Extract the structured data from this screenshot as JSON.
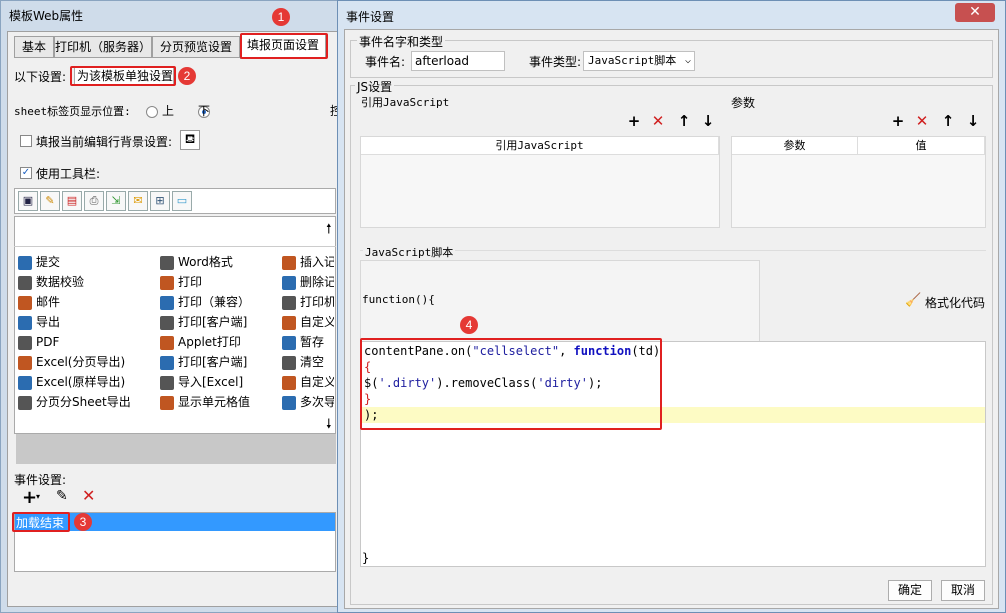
{
  "bg_window": {
    "title": "模板Web属性",
    "tabs": [
      "基本",
      "打印机（服务器）",
      "分页预览设置",
      "填报页面设置"
    ],
    "setting_label": "以下设置:",
    "setting_value": "为该模板单独设置",
    "sheet_pos_label": "sheet标签页显示位置:",
    "sheet_pos_top": "上",
    "sheet_pos_bottom": "下",
    "right_cut": "控",
    "fill_bg_label": "填报当前编辑行背景设置:",
    "use_toolbar_label": "使用工具栏:",
    "toolbar_icons": [
      "save-icon",
      "edit-icon",
      "pdf-icon",
      "print-icon",
      "export-icon",
      "mail-icon",
      "layout-icon",
      "sheet-icon"
    ],
    "grid_items": [
      [
        "提交",
        "Word格式",
        "插入记"
      ],
      [
        "数据校验",
        "打印",
        "删除记"
      ],
      [
        "邮件",
        "打印（兼容）",
        "打印机"
      ],
      [
        "导出",
        "打印[客户端]",
        "自定义"
      ],
      [
        "PDF",
        "Applet打印",
        "暂存"
      ],
      [
        "Excel(分页导出)",
        "打印[客户端]",
        "清空"
      ],
      [
        "Excel(原样导出)",
        "导入[Excel]",
        "自定义"
      ],
      [
        "分页分Sheet导出",
        "显示单元格值",
        "多次导"
      ]
    ],
    "event_label": "事件设置:",
    "event_item": "加载结束",
    "badges": [
      "1",
      "2",
      "3",
      "4"
    ]
  },
  "dialog": {
    "title": "事件设置",
    "close": "✕",
    "group_name_type": "事件名字和类型",
    "event_name_label": "事件名:",
    "event_name_value": "afterload",
    "event_type_label": "事件类型:",
    "event_type_value": "JavaScript脚本",
    "js_group": "JS设置",
    "ref_js_title": "引用JavaScript",
    "params_title": "参数",
    "ref_js_col": "引用JavaScript",
    "param_col": "参数",
    "value_col": "值",
    "script_group": "JavaScript脚本",
    "func_header": "function(){",
    "format_code": "格式化代码",
    "code_line1a": "contentPane.on(",
    "code_line1b": "\"cellselect\"",
    "code_line1c": ", ",
    "code_line1d": "function",
    "code_line1e": "(td)",
    "code_line2": "{",
    "code_line3a": "$(",
    "code_line3b": "'.dirty'",
    "code_line3c": ").removeClass(",
    "code_line3d": "'dirty'",
    "code_line3e": ");",
    "code_line4": "}",
    "code_line5": ");",
    "code_end": "}",
    "ok": "确定",
    "cancel": "取消"
  },
  "colors": {
    "red": "#e02020",
    "select_blue": "#3399ff",
    "highlight": "#fdfbc4",
    "keyword": "#1010c0",
    "string": "#2020a0",
    "accent_red": "#d02020"
  }
}
